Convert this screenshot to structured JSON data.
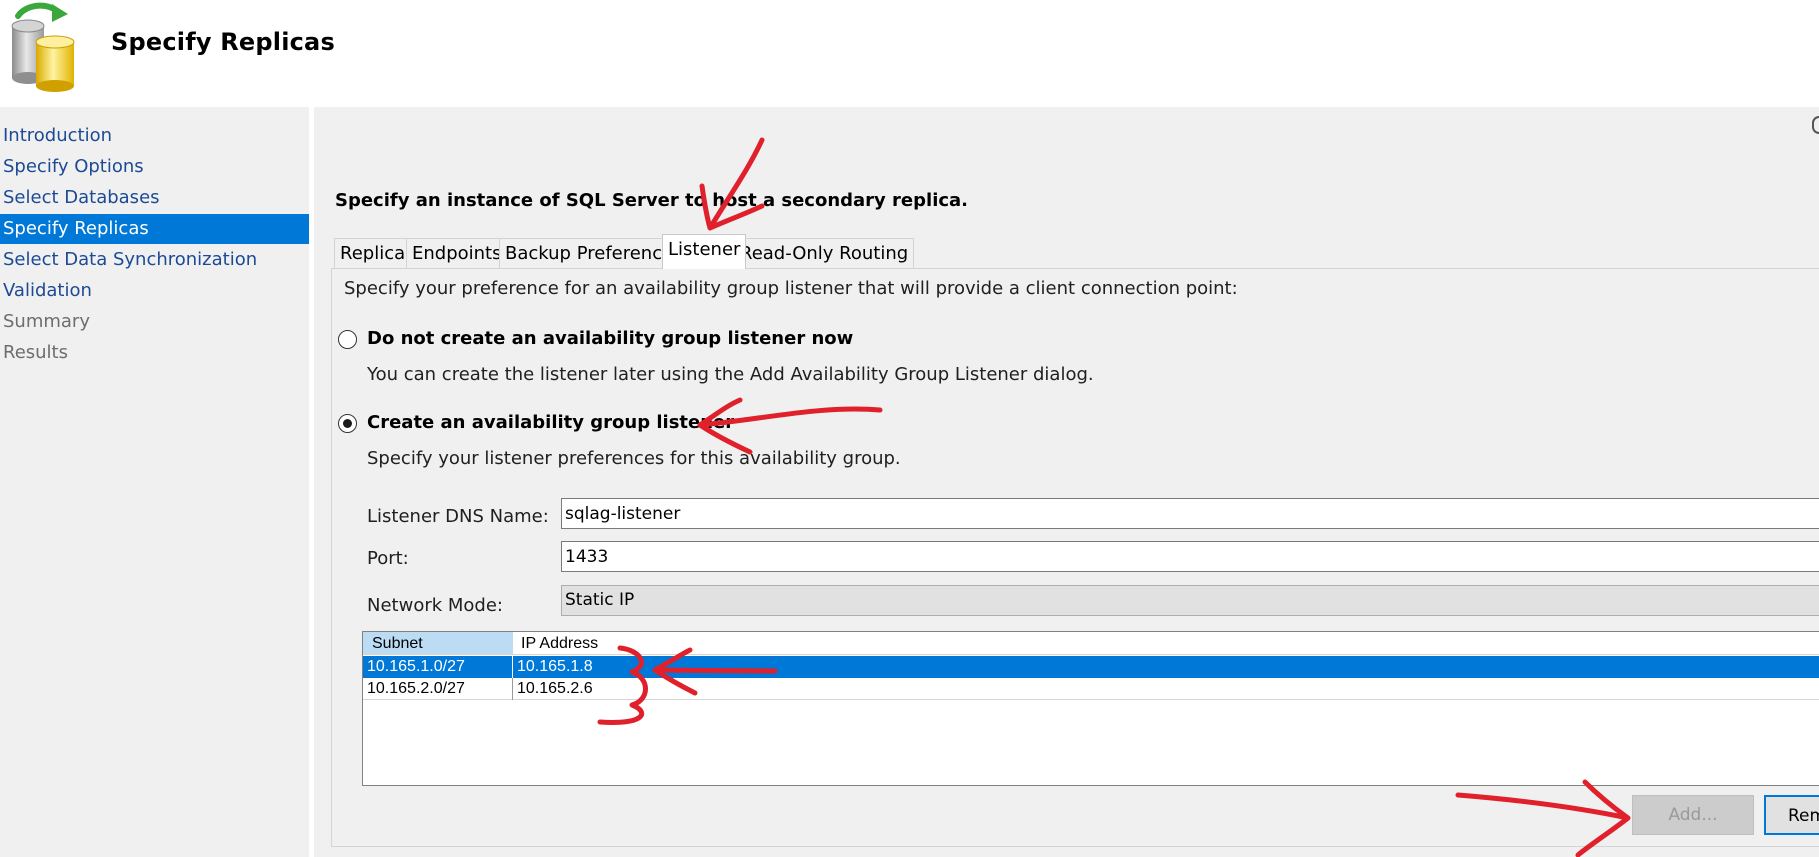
{
  "header": {
    "title": "Specify Replicas",
    "icon": "database-refresh-icon"
  },
  "sidebar": {
    "items": [
      {
        "label": "Introduction",
        "state": "link"
      },
      {
        "label": "Specify Options",
        "state": "link"
      },
      {
        "label": "Select Databases",
        "state": "link"
      },
      {
        "label": "Specify Replicas",
        "state": "active"
      },
      {
        "label": "Select Data Synchronization",
        "state": "link"
      },
      {
        "label": "Validation",
        "state": "link"
      },
      {
        "label": "Summary",
        "state": "disabled"
      },
      {
        "label": "Results",
        "state": "disabled"
      }
    ]
  },
  "main": {
    "instruction": "Specify an instance of SQL Server to host a secondary replica.",
    "tabs": [
      {
        "label": "Replicas"
      },
      {
        "label": "Endpoints"
      },
      {
        "label": "Backup Preferences"
      },
      {
        "label": "Listener",
        "active": true
      },
      {
        "label": "Read-Only Routing"
      }
    ]
  },
  "listener": {
    "description": "Specify your preference for an availability group listener that will provide a client connection point:",
    "option_none": {
      "label": "Do not create an availability group listener now",
      "help": "You can create the listener later using the Add Availability Group Listener dialog.",
      "checked": false
    },
    "option_create": {
      "label": "Create an availability group listener",
      "help": "Specify your listener preferences for this availability group.",
      "checked": true
    },
    "dns_label": "Listener DNS Name:",
    "dns_value": "sqlag-listener",
    "port_label": "Port:",
    "port_value": "1433",
    "mode_label": "Network Mode:",
    "mode_value": "Static IP",
    "grid": {
      "columns": [
        "Subnet",
        "IP Address"
      ],
      "rows": [
        {
          "subnet": "10.165.1.0/27",
          "ip": "10.165.1.8",
          "selected": true
        },
        {
          "subnet": "10.165.2.0/27",
          "ip": "10.165.2.6",
          "selected": false
        }
      ]
    },
    "add_button": "Add...",
    "remove_button": "Remove"
  },
  "colors": {
    "selection": "#0078d7",
    "nav_link": "#1c4a94",
    "panel_bg": "#f0f0f0",
    "annotation": "#e0202a"
  }
}
